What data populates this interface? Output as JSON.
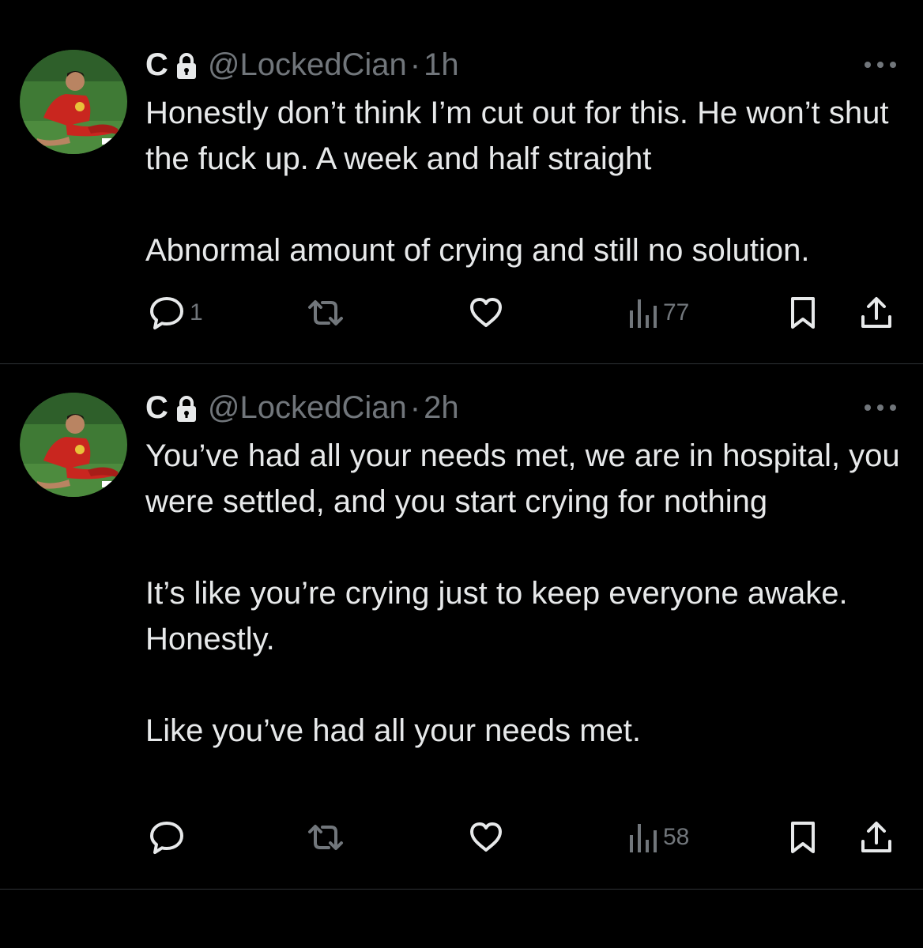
{
  "tweets": [
    {
      "display_name": "C",
      "handle": "@LockedCian",
      "separator": "·",
      "time": "1h",
      "paragraphs": [
        "Honestly don’t think I’m cut out for this. He won’t shut the fuck up. A week and half straight",
        "Abnormal amount of crying and still no solution."
      ],
      "actions": {
        "reply_count": "1",
        "retweet_count": "",
        "like_count": "",
        "views_count": "77"
      }
    },
    {
      "display_name": "C",
      "handle": "@LockedCian",
      "separator": "·",
      "time": "2h",
      "paragraphs": [
        "You’ve had all your needs met, we are in hospital, you were settled, and you start crying for nothing",
        "It’s like you’re crying just to keep everyone awake. Honestly.",
        "Like you’ve had all your needs met."
      ],
      "actions": {
        "reply_count": "",
        "retweet_count": "",
        "like_count": "",
        "views_count": "58"
      }
    }
  ],
  "icons": {
    "avatar": "avatar-photo",
    "lock": "lock-icon",
    "more": "more-options-icon",
    "reply": "reply-icon",
    "retweet": "retweet-icon",
    "like": "heart-icon",
    "views": "views-icon",
    "bookmark": "bookmark-icon",
    "share": "share-icon"
  },
  "colors": {
    "background": "#000000",
    "text_primary": "#e7e9ea",
    "text_secondary": "#71767b",
    "divider": "#2f3336"
  }
}
